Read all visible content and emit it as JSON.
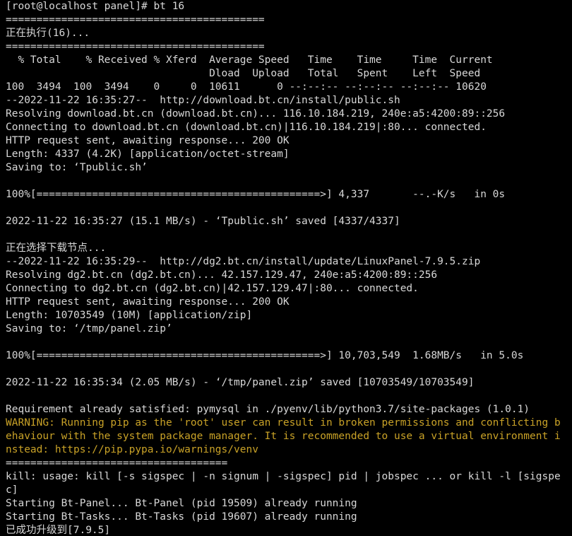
{
  "colors": {
    "background": "#000000",
    "text": "#d8d8d8",
    "warning": "#c9a227"
  },
  "terminal": {
    "lines": [
      {
        "text": "[root@localhost panel]# bt 16",
        "type": "normal"
      },
      {
        "text": "==========================================",
        "type": "normal"
      },
      {
        "text": "正在执行(16)...",
        "type": "normal"
      },
      {
        "text": "==========================================",
        "type": "normal"
      },
      {
        "text": "  % Total    % Received % Xferd  Average Speed   Time    Time     Time  Current",
        "type": "normal"
      },
      {
        "text": "                                 Dload  Upload   Total   Spent    Left  Speed",
        "type": "normal"
      },
      {
        "text": "100  3494  100  3494    0     0  10611      0 --:--:-- --:--:-- --:--:-- 10620",
        "type": "normal"
      },
      {
        "text": "--2022-11-22 16:35:27--  http://download.bt.cn/install/public.sh",
        "type": "normal"
      },
      {
        "text": "Resolving download.bt.cn (download.bt.cn)... 116.10.184.219, 240e:a5:4200:89::256",
        "type": "normal"
      },
      {
        "text": "Connecting to download.bt.cn (download.bt.cn)|116.10.184.219|:80... connected.",
        "type": "normal"
      },
      {
        "text": "HTTP request sent, awaiting response... 200 OK",
        "type": "normal"
      },
      {
        "text": "Length: 4337 (4.2K) [application/octet-stream]",
        "type": "normal"
      },
      {
        "text": "Saving to: ‘Tpublic.sh’",
        "type": "normal"
      },
      {
        "text": "",
        "type": "blank"
      },
      {
        "text": "100%[==============================================>] 4,337       --.-K/s   in 0s",
        "type": "normal"
      },
      {
        "text": "",
        "type": "blank"
      },
      {
        "text": "2022-11-22 16:35:27 (15.1 MB/s) - ‘Tpublic.sh’ saved [4337/4337]",
        "type": "normal"
      },
      {
        "text": "",
        "type": "blank"
      },
      {
        "text": "正在选择下载节点...",
        "type": "normal"
      },
      {
        "text": "--2022-11-22 16:35:29--  http://dg2.bt.cn/install/update/LinuxPanel-7.9.5.zip",
        "type": "normal"
      },
      {
        "text": "Resolving dg2.bt.cn (dg2.bt.cn)... 42.157.129.47, 240e:a5:4200:89::256",
        "type": "normal"
      },
      {
        "text": "Connecting to dg2.bt.cn (dg2.bt.cn)|42.157.129.47|:80... connected.",
        "type": "normal"
      },
      {
        "text": "HTTP request sent, awaiting response... 200 OK",
        "type": "normal"
      },
      {
        "text": "Length: 10703549 (10M) [application/zip]",
        "type": "normal"
      },
      {
        "text": "Saving to: ‘/tmp/panel.zip’",
        "type": "normal"
      },
      {
        "text": "",
        "type": "blank"
      },
      {
        "text": "100%[==============================================>] 10,703,549  1.68MB/s   in 5.0s",
        "type": "normal"
      },
      {
        "text": "",
        "type": "blank"
      },
      {
        "text": "2022-11-22 16:35:34 (2.05 MB/s) - ‘/tmp/panel.zip’ saved [10703549/10703549]",
        "type": "normal"
      },
      {
        "text": "",
        "type": "blank"
      },
      {
        "text": "Requirement already satisfied: pymysql in ./pyenv/lib/python3.7/site-packages (1.0.1)",
        "type": "normal"
      },
      {
        "text": "WARNING: Running pip as the 'root' user can result in broken permissions and conflicting b",
        "type": "warn"
      },
      {
        "text": "ehaviour with the system package manager. It is recommended to use a virtual environment i",
        "type": "warn"
      },
      {
        "text": "nstead: https://pip.pypa.io/warnings/venv",
        "type": "warn"
      },
      {
        "text": "====================================",
        "type": "normal"
      },
      {
        "text": "kill: usage: kill [-s sigspec | -n signum | -sigspec] pid | jobspec ... or kill -l [sigspe",
        "type": "normal"
      },
      {
        "text": "c]",
        "type": "normal"
      },
      {
        "text": "Starting Bt-Panel... Bt-Panel (pid 19509) already running",
        "type": "normal"
      },
      {
        "text": "Starting Bt-Tasks... Bt-Tasks (pid 19607) already running",
        "type": "normal"
      },
      {
        "text": "已成功升级到[7.9.5]",
        "type": "normal"
      }
    ]
  }
}
